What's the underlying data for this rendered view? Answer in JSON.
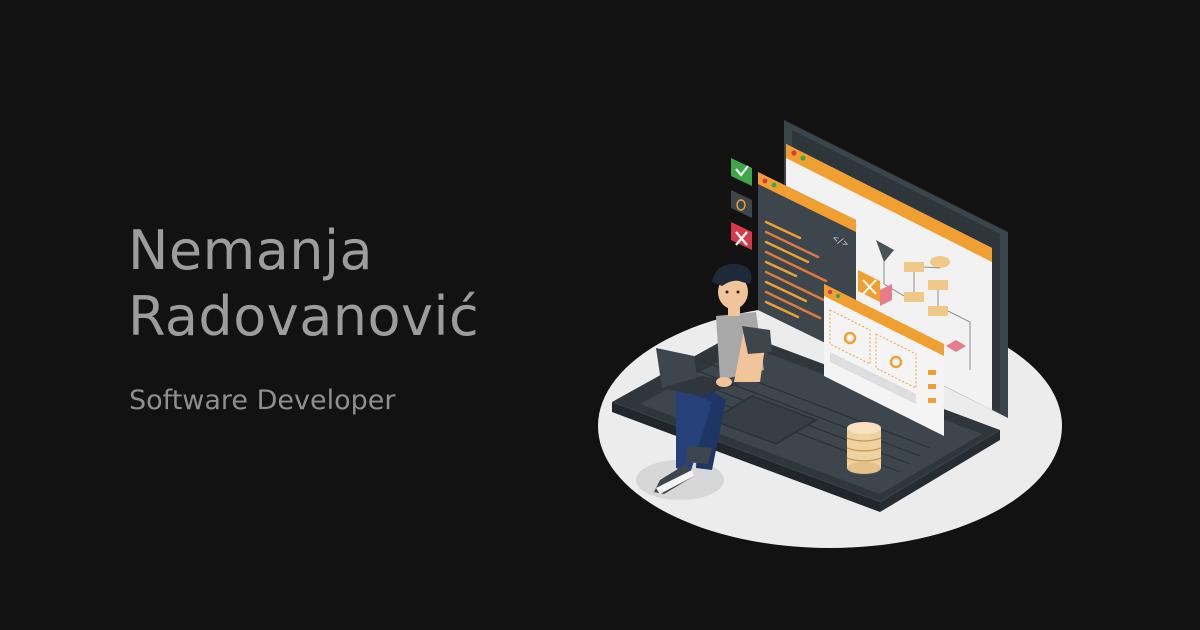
{
  "profile": {
    "name_line1": "Nemanja",
    "name_line2": "Radovanović",
    "title": "Software Developer"
  },
  "illustration": {
    "icons": [
      "check-icon",
      "bug-icon",
      "cross-icon",
      "code-tag-icon",
      "gear-icon",
      "tools-icon",
      "database-icon"
    ],
    "colors": {
      "background": "#121212",
      "text": "#9c9c9c",
      "accent_orange": "#f0a030",
      "laptop_dark": "#3d464d",
      "success_green": "#3fa64a",
      "error_red": "#d8394a"
    },
    "code_tag": "</>"
  }
}
